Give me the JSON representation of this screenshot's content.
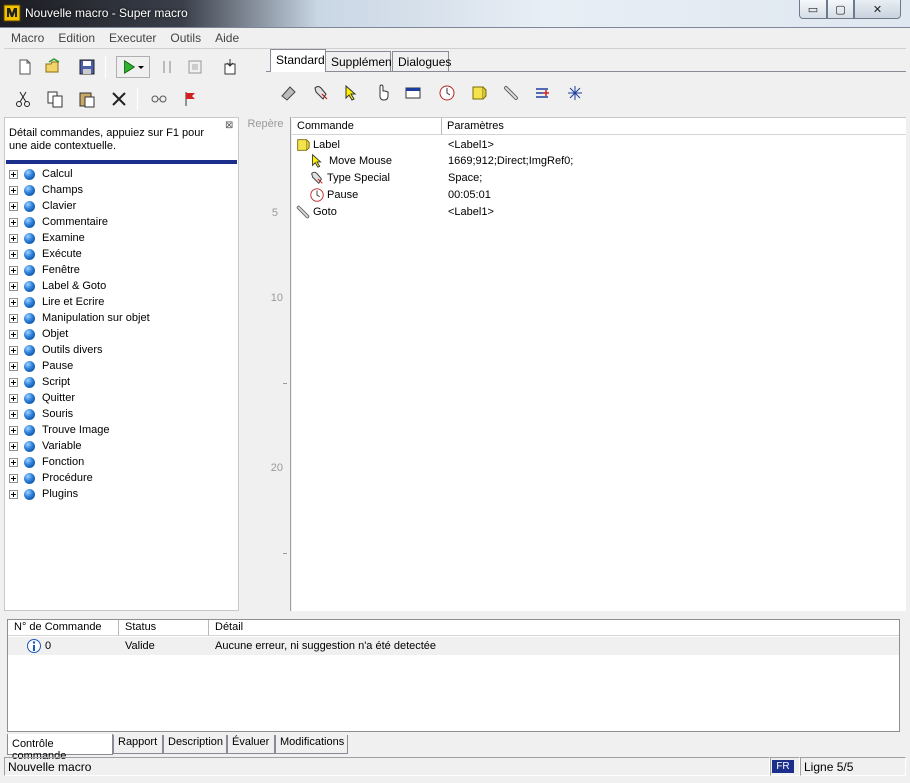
{
  "window": {
    "title": "Nouvelle macro - Super macro",
    "minimize_glyph": "▭",
    "maximize_glyph": "▢",
    "close_glyph": "✕"
  },
  "menu": [
    "Macro",
    "Edition",
    "Executer",
    "Outils",
    "Aide"
  ],
  "toolbar_left": {
    "row1": [
      "new-file-icon",
      "open-folder-icon",
      "save-icon",
      "run-icon",
      "run-dropdown-icon",
      "pause-icon",
      "stop-icon",
      "step-icon"
    ],
    "row2": [
      "cut-icon",
      "copy-icon",
      "paste-icon",
      "delete-icon",
      "record-icon",
      "flag-icon"
    ]
  },
  "tabs": [
    {
      "label": "Standard",
      "active": true
    },
    {
      "label": "Supplément",
      "active": false
    },
    {
      "label": "Dialogues",
      "active": false
    }
  ],
  "standard_toolbar": [
    "type-text-icon",
    "type-special-icon",
    "move-mouse-icon",
    "click-icon",
    "window-icon",
    "pause-clock-icon",
    "label-icon",
    "goto-icon",
    "variable-icon",
    "calc-icon"
  ],
  "help": {
    "text": "Détail commandes, appuiez sur F1 pour une aide contextuelle.",
    "close_glyph": "⊠"
  },
  "tree": [
    "Calcul",
    "Champs",
    "Clavier",
    "Commentaire",
    "Examine",
    "Exécute",
    "Fenêtre",
    "Label & Goto",
    "Lire et Ecrire",
    "Manipulation sur objet",
    "Objet",
    "Outils divers",
    "Pause",
    "Script",
    "Quitter",
    "Souris",
    "Trouve Image",
    "Variable",
    "Fonction",
    "Procédure",
    "Plugins"
  ],
  "gutter": {
    "header": "Repère",
    "numbers": [
      "5",
      "10",
      "20"
    ]
  },
  "columns": {
    "commande": "Commande",
    "parametres": "Paramètres"
  },
  "commands": [
    {
      "icon": "label-icon",
      "name": "Label",
      "param": "<Label1>",
      "indent": 0
    },
    {
      "icon": "move-mouse-icon",
      "name": "Move Mouse",
      "param": "1669;912;Direct;ImgRef0;",
      "indent": 1
    },
    {
      "icon": "type-special-icon",
      "name": "Type Special",
      "param": "Space;",
      "indent": 1
    },
    {
      "icon": "pause-clock-icon",
      "name": "Pause",
      "param": "00:05:01",
      "indent": 1
    },
    {
      "icon": "goto-icon",
      "name": "Goto",
      "param": "<Label1>",
      "indent": 0
    }
  ],
  "bottom": {
    "headers": [
      "N° de Commande",
      "Status",
      "Détail"
    ],
    "row": {
      "num": "0",
      "status": "Valide",
      "detail": "Aucune erreur, ni suggestion n'a été detectée"
    },
    "tabs": [
      "Contrôle commande",
      "Rapport",
      "Description",
      "Évaluer",
      "Modifications"
    ]
  },
  "status": {
    "left": "Nouvelle macro",
    "lang": "FR",
    "line": "Ligne 5/5"
  }
}
